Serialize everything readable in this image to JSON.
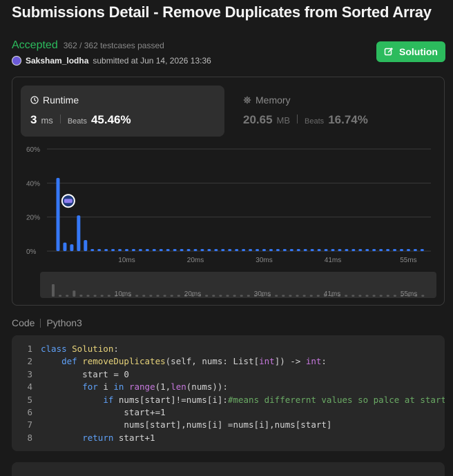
{
  "header": {
    "title": "Submissions Detail - Remove Duplicates from Sorted Array"
  },
  "status": {
    "verdict": "Accepted",
    "testcases": "362 / 362 testcases passed"
  },
  "submission": {
    "user": "Saksham_lodha",
    "submitted_text": "submitted at Jun 14, 2026 13:36"
  },
  "solution_button": {
    "label": "Solution",
    "icon": "edit-icon",
    "color": "#2cbb5d"
  },
  "runtime": {
    "label": "Runtime",
    "icon": "clock-icon",
    "value": "3",
    "unit": "ms",
    "beats_label": "Beats",
    "beats_value": "45.46%"
  },
  "memory": {
    "label": "Memory",
    "icon": "memory-chip-icon",
    "value": "20.65",
    "unit": "MB",
    "beats_label": "Beats",
    "beats_value": "16.74%"
  },
  "chart_data": {
    "type": "bar",
    "bar_color": "#3578f6",
    "ylim": [
      0,
      60
    ],
    "y_ticks": [
      "60%",
      "40%",
      "20%",
      "0%"
    ],
    "y_tick_values": [
      60,
      40,
      20,
      0
    ],
    "x_tick_labels": [
      "10ms",
      "20ms",
      "30ms",
      "41ms",
      "55ms"
    ],
    "x_tick_indices": [
      10,
      20,
      30,
      40,
      51
    ],
    "values": [
      43,
      5,
      4,
      21,
      6.5,
      1.2,
      1.2,
      1.2,
      1.2,
      1.2,
      1.2,
      1.2,
      1.2,
      1.2,
      1.2,
      1.2,
      1.2,
      1.2,
      1.2,
      1.2,
      1.2,
      1.2,
      1.2,
      1.2,
      1.2,
      1.2,
      1.2,
      1.2,
      1.2,
      1.2,
      1.2,
      1.2,
      1.2,
      1.2,
      1.2,
      1.2,
      1.2,
      1.2,
      1.2,
      1.2,
      1.2,
      1.2,
      1.2,
      1.2,
      1.2,
      1.2,
      1.2,
      1.2,
      1.2,
      1.2,
      1.2,
      1.2,
      1.2,
      1.2
    ],
    "marker_index": 3,
    "overview_x_tick_labels": [
      "10ms",
      "20ms",
      "30ms",
      "41ms",
      "55ms"
    ]
  },
  "code": {
    "label": "Code",
    "language": "Python3",
    "line_numbers": [
      "1",
      "2",
      "3",
      "4",
      "5",
      "6",
      "7",
      "8"
    ],
    "lines": [
      [
        {
          "c": "k",
          "t": "class "
        },
        {
          "c": "fn",
          "t": "Solution"
        },
        {
          "c": "t",
          "t": ":"
        }
      ],
      [
        {
          "c": "t",
          "t": "    "
        },
        {
          "c": "k",
          "t": "def "
        },
        {
          "c": "fn",
          "t": "removeDuplicates"
        },
        {
          "c": "t",
          "t": "(self, nums: List["
        },
        {
          "c": "bt",
          "t": "int"
        },
        {
          "c": "t",
          "t": "]) -> "
        },
        {
          "c": "bt",
          "t": "int"
        },
        {
          "c": "t",
          "t": ":"
        }
      ],
      [
        {
          "c": "t",
          "t": "        start = 0"
        }
      ],
      [
        {
          "c": "t",
          "t": "        "
        },
        {
          "c": "k",
          "t": "for "
        },
        {
          "c": "t",
          "t": "i "
        },
        {
          "c": "k",
          "t": "in "
        },
        {
          "c": "bt",
          "t": "range"
        },
        {
          "c": "t",
          "t": "(1,"
        },
        {
          "c": "bt",
          "t": "len"
        },
        {
          "c": "t",
          "t": "(nums)):"
        }
      ],
      [
        {
          "c": "t",
          "t": "            "
        },
        {
          "c": "k",
          "t": "if "
        },
        {
          "c": "t",
          "t": "nums[start]!=nums[i]:"
        },
        {
          "c": "cm",
          "t": "#means differernt values so palce at start"
        }
      ],
      [
        {
          "c": "t",
          "t": "                start+=1"
        }
      ],
      [
        {
          "c": "t",
          "t": "                nums[start],nums[i] =nums[i],nums[start]"
        }
      ],
      [
        {
          "c": "t",
          "t": "        "
        },
        {
          "c": "k",
          "t": "return "
        },
        {
          "c": "t",
          "t": "start+1"
        }
      ]
    ]
  }
}
